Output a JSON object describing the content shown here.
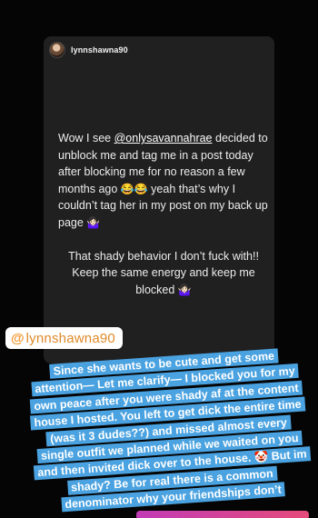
{
  "post": {
    "username": "lynnshawna90",
    "text_part1_a": "Wow I see ",
    "mention": "@onlysavannahrae",
    "text_part1_b": " decided to unblock me and tag me in a post today after blocking me for no reason a few months ago ",
    "emoji_laugh": "😂😂",
    "text_part1_c": " yeah that’s why I couldn’t tag her in my post on my back up page ",
    "emoji_shrug": "🤷🏻‍♀️",
    "text_part2": "That shady behavior I don’t fuck with!! Keep the same energy and keep me blocked ",
    "emoji_shrug2": "🤷🏻‍♀️"
  },
  "sticker": {
    "at_symbol": "@",
    "username": "lynnshawna90"
  },
  "overlay": {
    "text": "Since she wants to be cute and get some attention— Let me clarify— I blocked you for my own peace after you were shady af at the content house I hosted. You left to get dick the entire time (was it 3 dudes??) and missed almost every single outfit we planned while we waited on you and then invited dick over to the house. 🤡 But im shady? Be for real there is a common denominator why your friendships don’t"
  },
  "colors": {
    "highlight": "#4aa2e0",
    "card": "#202020",
    "sticker_text": "#e08a2a"
  }
}
